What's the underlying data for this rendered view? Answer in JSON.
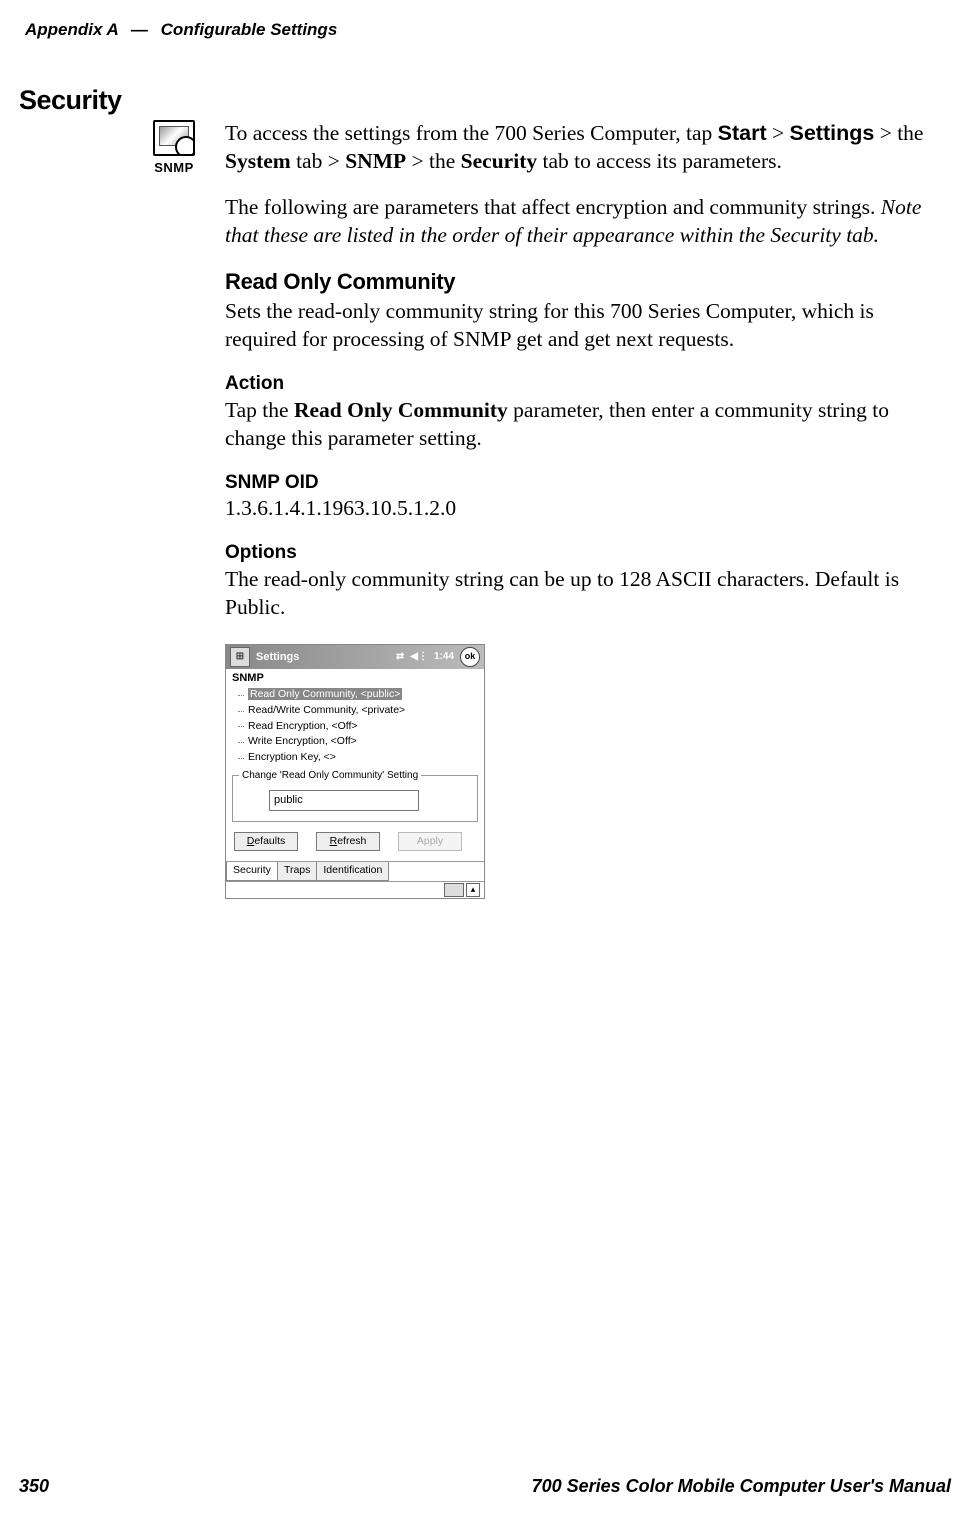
{
  "header": {
    "appendix": "Appendix A",
    "dash": "—",
    "title": "Configurable Settings"
  },
  "section_heading": "Security",
  "icon": {
    "label": "SNMP"
  },
  "intro": {
    "p1_a": "To access the settings from the 700 Series Computer, tap ",
    "p1_start": "Start",
    "p1_gt1": " > ",
    "p1_settings": "Settings",
    "p1_b": " > the ",
    "p1_system": "System",
    "p1_c": " tab > ",
    "p1_snmp": "SNMP",
    "p1_d": " > the ",
    "p1_security": "Security",
    "p1_e": " tab to access its parameters.",
    "p2_a": "The following are parameters that affect encryption and community strings. ",
    "p2_note": "Note that these are listed in the order of their appearance within the Security tab."
  },
  "roc": {
    "heading": "Read Only Community",
    "body": "Sets the read-only community string for this 700 Series Computer, which is required for processing of SNMP get and get next requests."
  },
  "action": {
    "heading": "Action",
    "a": "Tap the ",
    "param": "Read Only Community",
    "b": " parameter, then enter a community string to change this parameter setting."
  },
  "oid": {
    "heading": "SNMP OID",
    "value": "1.3.6.1.4.1.1963.10.5.1.2.0"
  },
  "options": {
    "heading": "Options",
    "body": "The read-only community string can be up to 128 ASCII characters. Default is Public."
  },
  "shot": {
    "title": "Settings",
    "time": "1:44",
    "ok": "ok",
    "app": "SNMP",
    "tree": [
      "Read Only Community, <public>",
      "Read/Write Community, <private>",
      "Read Encryption, <Off>",
      "Write Encryption, <Off>",
      "Encryption Key, <>"
    ],
    "group_title": "Change 'Read Only Community' Setting",
    "input_value": "public",
    "buttons": {
      "defaults": "Defaults",
      "refresh": "Refresh",
      "apply": "Apply"
    },
    "tabs": [
      "Security",
      "Traps",
      "Identification"
    ]
  },
  "footer": {
    "page": "350",
    "manual": "700 Series Color Mobile Computer User's Manual"
  }
}
